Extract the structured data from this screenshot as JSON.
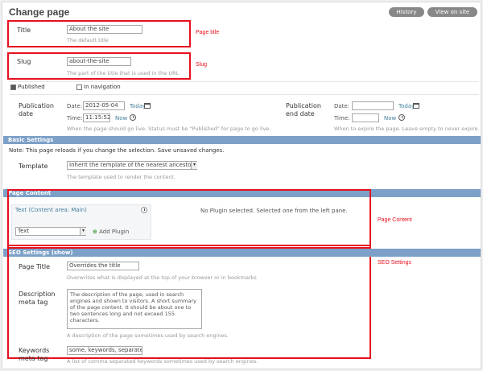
{
  "header": {
    "title": "Change page",
    "buttons": [
      "History",
      "View on site"
    ]
  },
  "annotations": {
    "page_title": "Page title",
    "slug": "Slug",
    "page_content": "Page Content",
    "seo_settings": "SEO Settings"
  },
  "colors": {
    "accent_red": "#e8101e",
    "section_blue": "#7ca0c7",
    "link": "#447e9b"
  },
  "fields": {
    "title": {
      "label": "Title",
      "value": "About the site",
      "help": "The default title"
    },
    "slug": {
      "label": "Slug",
      "value": "about-the-site",
      "help": "The part of the title that is used in the URL"
    },
    "published": {
      "label": "Published",
      "checked": true
    },
    "in_navigation": {
      "label": "In navigation",
      "checked": false
    },
    "publication_date": {
      "label": "Publication date",
      "date_label": "Date:",
      "date_value": "2012-05-04",
      "date_link": "Today",
      "time_label": "Time:",
      "time_value": "11:15:52",
      "time_link": "Now",
      "help": "When the page should go live. Status must be \"Published\" for page to go live."
    },
    "publication_end_date": {
      "label": "Publication end date",
      "date_label": "Date:",
      "date_link": "Today",
      "time_label": "Time:",
      "time_link": "Now",
      "help": "When to expire the page. Leave empty to never expire."
    }
  },
  "basic_settings": {
    "title": "Basic Settings",
    "intro": "Note: This page reloads if you change the selection. Save unsaved changes.",
    "template_label": "Template",
    "template_value": "Inherit the template of the nearest ancestor",
    "template_help": "The template used to render the content."
  },
  "page_content": {
    "title": "Page Content",
    "language_link": "Text (Content area: Main)",
    "plugin_select": "Text",
    "add_plugin": "Add Plugin",
    "right_text": "No Plugin selected. Selected one from the left pane."
  },
  "seo": {
    "title": "SEO Settings (show)",
    "page_title_label": "Page Title",
    "page_title_value": "Overrides the title",
    "page_title_help": "Overwrites what is displayed at the top of your browser or in bookmarks",
    "description_label": "Description meta tag",
    "description_value": "The description of the page, used in search engines and shown to visitors. A short summary of the page content. It should be about one to two sentences long and not exceed 155 characters.",
    "description_help": "A description of the page sometimes used by search engines.",
    "keywords_label": "Keywords meta tag",
    "keywords_value": "some, keywords, separated",
    "keywords_help": "A list of comma separated keywords sometimes used by search engines."
  }
}
